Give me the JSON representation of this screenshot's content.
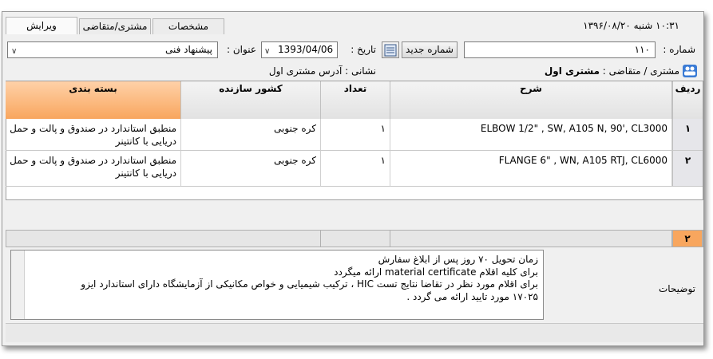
{
  "tabs": [
    {
      "label": "ویرایش",
      "active": true
    },
    {
      "label": "مشتری/متقاضی",
      "active": false
    },
    {
      "label": "مشخصات",
      "active": false
    }
  ],
  "header": {
    "datetime": "۱۰:۳۱  شنبه ۱۳۹۶/۰۸/۲۰"
  },
  "form": {
    "number_label": "شماره :",
    "number_value": "۱۱۰",
    "new_number_button": "شماره جدید",
    "date_label": "تاریخ :",
    "date_value": "1393/04/06",
    "title_label": "عنوان :",
    "title_value": "پیشنهاد فنی",
    "customer_label": "مشتری / متقاضی :",
    "customer_value": "مشتری اول",
    "address_label": "نشانی : آدرس مشتری اول"
  },
  "grid": {
    "columns": [
      "ردیف",
      "شرح",
      "تعداد",
      "کشور سازنده",
      "بسته بندی"
    ],
    "rows": [
      {
        "num": "۱",
        "description": "ELBOW 1/2\" , SW, A105 N, 90', CL3000",
        "qty": "۱",
        "country": "کره جنوبی",
        "packing": "منطبق استاندارد در صندوق و پالت و حمل دریایی با کانتینر"
      },
      {
        "num": "۲",
        "description": "FLANGE 6\" , WN, A105 RTJ, CL6000",
        "qty": "۱",
        "country": "کره جنوبی",
        "packing": "منطبق استاندارد در صندوق و پالت و حمل دریایی با کانتینر"
      }
    ],
    "footer_count": "۲"
  },
  "notes": {
    "label": "توضیحات",
    "lines": [
      "زمان تحویل ۷۰ روز پس از ابلاغ سفارش",
      "برای کلیه اقلام material certificate ارائه میگردد",
      "برای اقلام مورد نظر در تقاضا نتایج تست HIC ، ترکیب شیمیایی و خواص مکانیکی از آزمایشگاه دارای استاندارد ایزو",
      "۱۷۰۲۵ مورد تایید ارائه می گردد ."
    ]
  },
  "colors": {
    "accent_orange": "#f8a65e",
    "frame_bg": "#f0f0f0"
  }
}
